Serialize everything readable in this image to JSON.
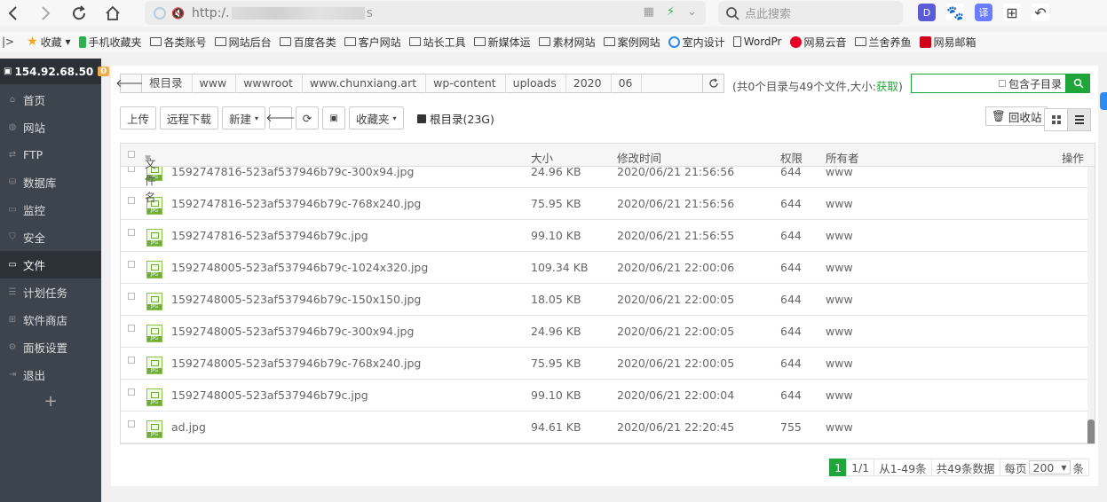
{
  "browser": {
    "url_prefix": "http:/.",
    "url_suffix": "s",
    "search_placeholder": "点此搜索"
  },
  "bookmarks": [
    {
      "label": "收藏",
      "icon": "star-icon"
    },
    {
      "label": "手机收藏夹",
      "icon": "phone-icon"
    },
    {
      "label": "各类账号",
      "icon": "folder-icon"
    },
    {
      "label": "网站后台",
      "icon": "folder-icon"
    },
    {
      "label": "百度各类",
      "icon": "folder-icon"
    },
    {
      "label": "客户网站",
      "icon": "folder-icon"
    },
    {
      "label": "站长工具",
      "icon": "folder-icon"
    },
    {
      "label": "新媒体运",
      "icon": "folder-icon"
    },
    {
      "label": "素材网站",
      "icon": "folder-icon"
    },
    {
      "label": "案例网站",
      "icon": "folder-icon"
    },
    {
      "label": "室内设计",
      "icon": "globe-icon"
    },
    {
      "label": "WordPr",
      "icon": "page-icon"
    },
    {
      "label": "网易云音",
      "icon": "netease-icon"
    },
    {
      "label": "兰舍养鱼",
      "icon": "folder-icon"
    },
    {
      "label": "网易邮箱",
      "icon": "mail-icon"
    }
  ],
  "sidebar": {
    "server_ip": "154.92.68.50",
    "badge": "0",
    "items": [
      {
        "label": "首页",
        "icon": "home-icon"
      },
      {
        "label": "网站",
        "icon": "globe-icon"
      },
      {
        "label": "FTP",
        "icon": "ftp-icon"
      },
      {
        "label": "数据库",
        "icon": "database-icon"
      },
      {
        "label": "监控",
        "icon": "monitor-icon"
      },
      {
        "label": "安全",
        "icon": "shield-icon"
      },
      {
        "label": "文件",
        "icon": "folder-icon",
        "active": true
      },
      {
        "label": "计划任务",
        "icon": "task-icon"
      },
      {
        "label": "软件商店",
        "icon": "store-icon"
      },
      {
        "label": "面板设置",
        "icon": "settings-icon"
      },
      {
        "label": "退出",
        "icon": "logout-icon"
      }
    ],
    "add": "+"
  },
  "path": {
    "crumbs": [
      "根目录",
      "www",
      "wwwroot",
      "www.chunxiang.art",
      "wp-content",
      "uploads",
      "2020",
      "06"
    ],
    "summary_prefix": "(共0个目录与49个文件,大小:",
    "summary_link": "获取",
    "summary_suffix": ")",
    "include_subdir": "包含子目录"
  },
  "toolbar": {
    "upload": "上传",
    "remote_download": "远程下载",
    "new": "新建",
    "favorites": "收藏夹",
    "disk": "根目录(23G)",
    "recycle": "回收站"
  },
  "table": {
    "headers": {
      "name": "文件名",
      "size": "大小",
      "mtime": "修改时间",
      "perm": "权限",
      "owner": "所有者",
      "ops": "操作"
    },
    "rows": [
      {
        "name": "1592747816-523af537946b79c-300x94.jpg",
        "size": "24.96 KB",
        "mtime": "2020/06/21 21:56:56",
        "perm": "644",
        "owner": "www"
      },
      {
        "name": "1592747816-523af537946b79c-768x240.jpg",
        "size": "75.95 KB",
        "mtime": "2020/06/21 21:56:56",
        "perm": "644",
        "owner": "www"
      },
      {
        "name": "1592747816-523af537946b79c.jpg",
        "size": "99.10 KB",
        "mtime": "2020/06/21 21:56:55",
        "perm": "644",
        "owner": "www"
      },
      {
        "name": "1592748005-523af537946b79c-1024x320.jpg",
        "size": "109.34 KB",
        "mtime": "2020/06/21 22:00:06",
        "perm": "644",
        "owner": "www"
      },
      {
        "name": "1592748005-523af537946b79c-150x150.jpg",
        "size": "18.05 KB",
        "mtime": "2020/06/21 22:00:05",
        "perm": "644",
        "owner": "www"
      },
      {
        "name": "1592748005-523af537946b79c-300x94.jpg",
        "size": "24.96 KB",
        "mtime": "2020/06/21 22:00:05",
        "perm": "644",
        "owner": "www"
      },
      {
        "name": "1592748005-523af537946b79c-768x240.jpg",
        "size": "75.95 KB",
        "mtime": "2020/06/21 22:00:05",
        "perm": "644",
        "owner": "www"
      },
      {
        "name": "1592748005-523af537946b79c.jpg",
        "size": "99.10 KB",
        "mtime": "2020/06/21 22:00:04",
        "perm": "644",
        "owner": "www"
      },
      {
        "name": "ad.jpg",
        "size": "94.61 KB",
        "mtime": "2020/06/21 22:20:45",
        "perm": "755",
        "owner": "www"
      }
    ]
  },
  "pager": {
    "current": "1",
    "pages": "1/1",
    "range": "从1-49条",
    "total": "共49条数据",
    "per_page_label": "每页",
    "per_page": "200",
    "unit": "条"
  },
  "colors": {
    "accent": "#20a53a",
    "sidebar": "#3c444d"
  }
}
